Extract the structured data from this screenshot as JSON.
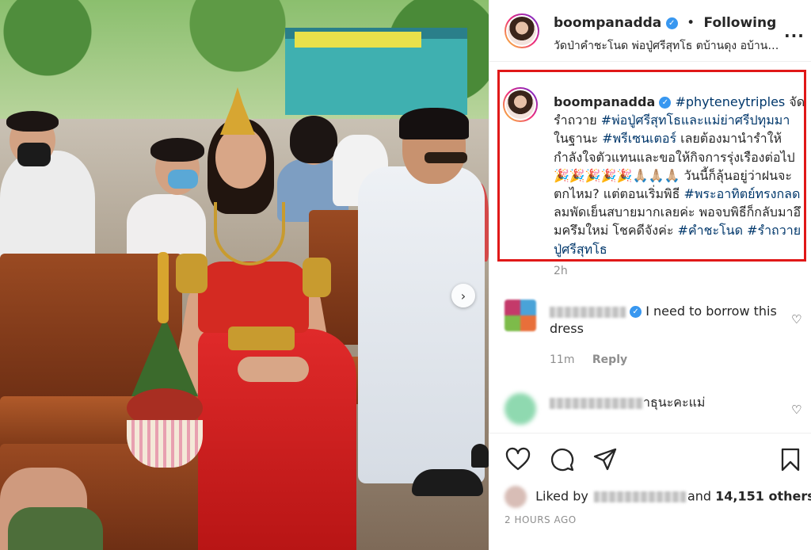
{
  "post": {
    "username": "boompanadda",
    "follow_separator": "•",
    "follow_status": "Following",
    "location": "วัดป่าคำชะโนด พ่อปู่ศรีสุทโธ ตบ้านดุง อบ้านดุง จ...",
    "more_label": "..."
  },
  "caption": {
    "username": "boompanadda",
    "parts": [
      {
        "t": "#phyteneytriples",
        "tag": true
      },
      {
        "t": " จัดรำถวาย ",
        "tag": false
      },
      {
        "t": "#พ่อปู่ศรีสุทโธและแม่ย่าศรีปทุมมา",
        "tag": true
      },
      {
        "t": " ในฐานะ ",
        "tag": false
      },
      {
        "t": "#พรีเซนเตอร์",
        "tag": true
      },
      {
        "t": " เลยต้องมานำรำให้กำลังใจตัวแทนและขอให้กิจการรุ่งเรืองต่อไป 🎉🎉🎉🎉🎉🙏🏼🙏🏼🙏🏼 วันนี้ก็ลุ้นอยู่ว่าฝนจะตกไหม? แต่ตอนเริ่มพิธี ",
        "tag": false
      },
      {
        "t": "#พระอาทิตย์ทรงกลด",
        "tag": true
      },
      {
        "t": " ลมพัดเย็นสบายมากเลยค่ะ พอจบพิธีก็กลับมาอึมครึมใหม่ โชคดีจังค่ะ ",
        "tag": false
      },
      {
        "t": "#คำชะโนด",
        "tag": true
      },
      {
        "t": " ",
        "tag": false
      },
      {
        "t": "#รำถวายปู่ศรีสุทโธ",
        "tag": true
      }
    ],
    "time": "2h"
  },
  "comments": [
    {
      "text": "I need to borrow this dress",
      "time": "11m",
      "reply_label": "Reply"
    },
    {
      "text": "าธุนะคะแม่"
    }
  ],
  "actions": {
    "liked_by_prefix": "Liked by",
    "liked_by_and": "and",
    "others_count": "14,151 others",
    "timestamp": "2 HOURS AGO"
  },
  "icons": {
    "verified": "verified-badge-icon",
    "like": "heart-icon",
    "comment": "comment-bubble-icon",
    "share": "paper-plane-icon",
    "save": "bookmark-icon",
    "carousel_next": "chevron-right-icon"
  },
  "colors": {
    "hashtag": "#00376b",
    "highlight_border": "#e01818",
    "verified": "#3897f0",
    "muted": "#8e8e8e"
  }
}
